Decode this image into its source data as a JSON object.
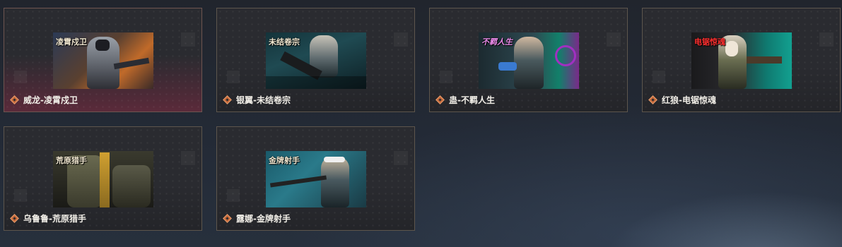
{
  "skins": [
    {
      "name": "威龙-凌霄戍卫",
      "logo": "凌霄戍卫",
      "icon": "skin-badge-icon",
      "selected": true
    },
    {
      "name": "银翼-未结卷宗",
      "logo": "未结卷宗",
      "icon": "skin-badge-icon",
      "selected": false
    },
    {
      "name": "蛊-不羁人生",
      "logo": "不羁人生",
      "icon": "skin-badge-icon",
      "selected": false
    },
    {
      "name": "红狼-电锯惊魂",
      "logo": "电锯惊魂",
      "icon": "skin-badge-icon",
      "selected": false
    },
    {
      "name": "乌鲁鲁-荒原猎手",
      "logo": "荒原猎手",
      "icon": "skin-badge-icon",
      "selected": false
    },
    {
      "name": "露娜-金牌射手",
      "logo": "金牌射手",
      "icon": "skin-badge-icon",
      "selected": false
    }
  ],
  "colors": {
    "accent": "#c86a3a",
    "selected_glow": "#96284a",
    "card_border": "#5d564d"
  }
}
